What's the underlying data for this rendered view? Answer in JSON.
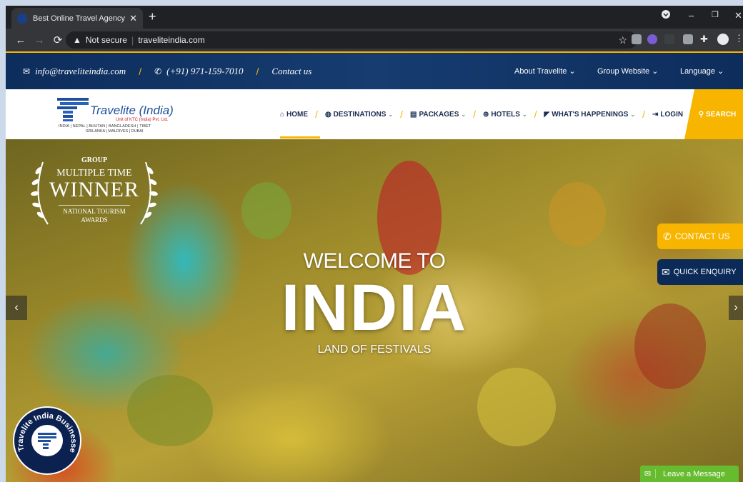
{
  "browser": {
    "tab_title": "Best Online Travel Agency India |",
    "tab_close": "✕",
    "new_tab": "+",
    "window_controls": [
      "–",
      "❐",
      "✕"
    ],
    "security_label": "Not secure",
    "url": "traveliteindia.com",
    "icons": [
      "back-icon",
      "forward-icon",
      "reload-icon",
      "warning-icon",
      "star-icon",
      "extensions-icon",
      "profile-icon"
    ]
  },
  "topbar": {
    "email": "info@traveliteindia.com",
    "phone": "(+91) 971-159-7010",
    "contact": "Contact us",
    "about": "About Travelite ⌄",
    "group": "Group Website ⌄",
    "language": "Language ⌄"
  },
  "logo": {
    "name": "Travelite (India)",
    "subtitle": "Unit of KTC (India) Pvt. Ltd.",
    "line1": "INDIA | NEPAL | BHUTAN | BANGLADESH | TIBET",
    "line2": "SRILANKA | MALDIVES | DUBAI"
  },
  "nav": {
    "home": "HOME",
    "destinations": "DESTINATIONS",
    "packages": "PACKAGES",
    "hotels": "HOTELS",
    "happenings": "WHAT'S HAPPENINGS",
    "login": "LOGIN",
    "search": "SEARCH",
    "separator": "/"
  },
  "award": {
    "group": "GROUP",
    "multiple": "MULTIPLE TIME",
    "winner": "WINNER",
    "national": "NATIONAL TOURISM",
    "awards": "AWARDS"
  },
  "hero": {
    "welcome": "WELCOME TO",
    "title": "INDIA",
    "tagline": "LAND OF FESTIVALS"
  },
  "sidebar": {
    "contact": "CONTACT US",
    "enquiry": "QUICK ENQUIRY"
  },
  "badge": {
    "text": "Travelite India Businesses"
  },
  "chat": {
    "label": "Leave a Message"
  },
  "colors": {
    "accent": "#f7b500",
    "navy": "#0c2a57",
    "chat_green": "#66bb2e"
  }
}
